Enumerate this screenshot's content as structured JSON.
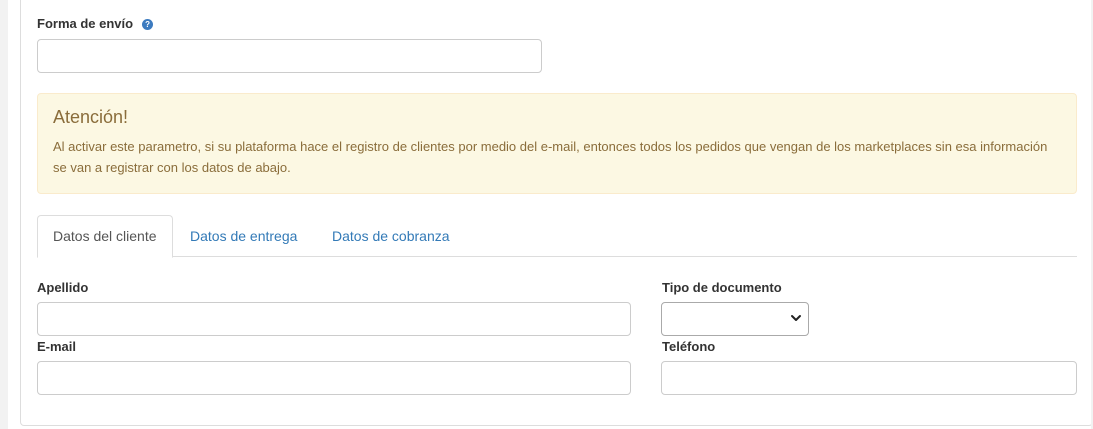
{
  "shipping": {
    "label": "Forma de envío",
    "help_icon": "?",
    "value": ""
  },
  "alert": {
    "title": "Atención!",
    "message": "Al activar este parametro, si su plataforma hace el registro de clientes por medio del e-mail, entonces todos los pedidos que vengan de los marketplaces sin esa información se van a registrar con los datos de abajo."
  },
  "tabs": [
    {
      "label": "Datos del cliente",
      "active": true
    },
    {
      "label": "Datos de entrega",
      "active": false
    },
    {
      "label": "Datos de cobranza",
      "active": false
    }
  ],
  "form": {
    "apellido_label": "Apellido",
    "apellido_value": "",
    "tipo_documento_label": "Tipo de documento",
    "tipo_documento_value": "",
    "email_label": "E-mail",
    "email_value": "",
    "telefono_label": "Teléfono",
    "telefono_value": ""
  },
  "colors": {
    "link": "#337ab7",
    "alert_bg": "#fcf8e3",
    "alert_text": "#8a6d3b",
    "help_icon": "#3c7bc0"
  }
}
